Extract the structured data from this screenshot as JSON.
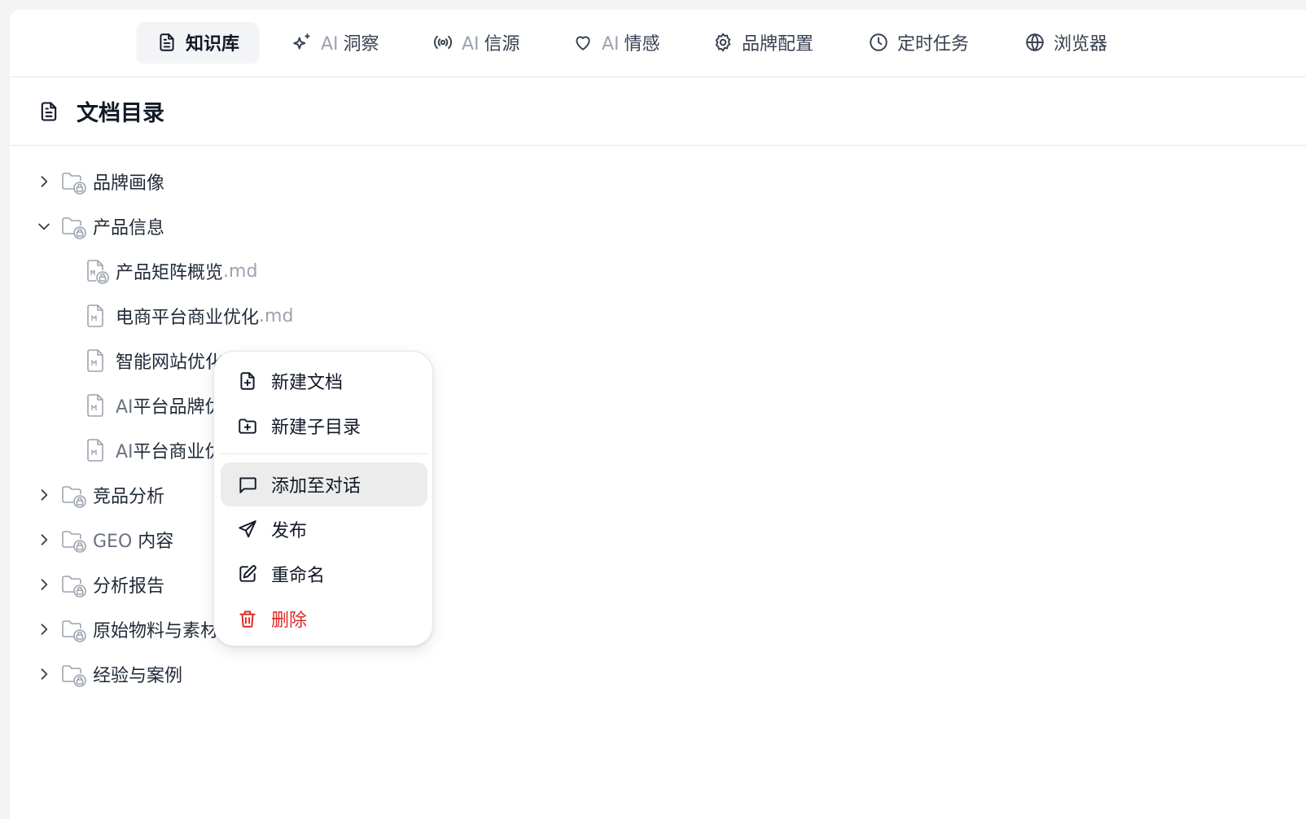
{
  "nav": {
    "tabs": [
      {
        "label": "知识库",
        "prefix": "",
        "active": true,
        "icon": "document-icon"
      },
      {
        "label": "洞察",
        "prefix": "AI",
        "active": false,
        "icon": "sparkles-icon"
      },
      {
        "label": "信源",
        "prefix": "AI",
        "active": false,
        "icon": "broadcast-icon"
      },
      {
        "label": "情感",
        "prefix": "AI",
        "active": false,
        "icon": "heart-icon"
      },
      {
        "label": "品牌配置",
        "prefix": "",
        "active": false,
        "icon": "gear-icon"
      },
      {
        "label": "定时任务",
        "prefix": "",
        "active": false,
        "icon": "clock-icon"
      },
      {
        "label": "浏览器",
        "prefix": "",
        "active": false,
        "icon": "globe-icon"
      }
    ]
  },
  "section": {
    "title": "文档目录"
  },
  "tree": {
    "items": [
      {
        "label": "品牌画像",
        "type": "folder",
        "expanded": false
      },
      {
        "label": "产品信息",
        "type": "folder",
        "expanded": true
      },
      {
        "label": "产品矩阵概览",
        "ext": ".md",
        "type": "file",
        "locked": true
      },
      {
        "label": "电商平台商业优化",
        "ext": ".md",
        "type": "file"
      },
      {
        "label": "智能网站优化",
        "type": "file"
      },
      {
        "label": "平台品牌优",
        "prefix": "AI",
        "type": "file"
      },
      {
        "label": "平台商业优",
        "prefix": "AI",
        "type": "file"
      },
      {
        "label": "竞品分析",
        "type": "folder",
        "expanded": false
      },
      {
        "label": "内容",
        "prefix": "GEO ",
        "type": "folder",
        "expanded": false
      },
      {
        "label": "分析报告",
        "type": "folder",
        "expanded": false
      },
      {
        "label": "原始物料与素材",
        "type": "folder",
        "expanded": false
      },
      {
        "label": "经验与案例",
        "type": "folder",
        "expanded": false
      }
    ]
  },
  "context_menu": {
    "items": [
      {
        "label": "新建文档",
        "icon": "file-plus-icon"
      },
      {
        "label": "新建子目录",
        "icon": "folder-plus-icon"
      },
      {
        "label": "添加至对话",
        "icon": "message-square-icon",
        "hovered": true
      },
      {
        "label": "发布",
        "icon": "send-icon"
      },
      {
        "label": "重命名",
        "icon": "edit-icon"
      },
      {
        "label": "删除",
        "icon": "trash-icon",
        "danger": true
      }
    ],
    "danger_color": "#dc2626"
  }
}
